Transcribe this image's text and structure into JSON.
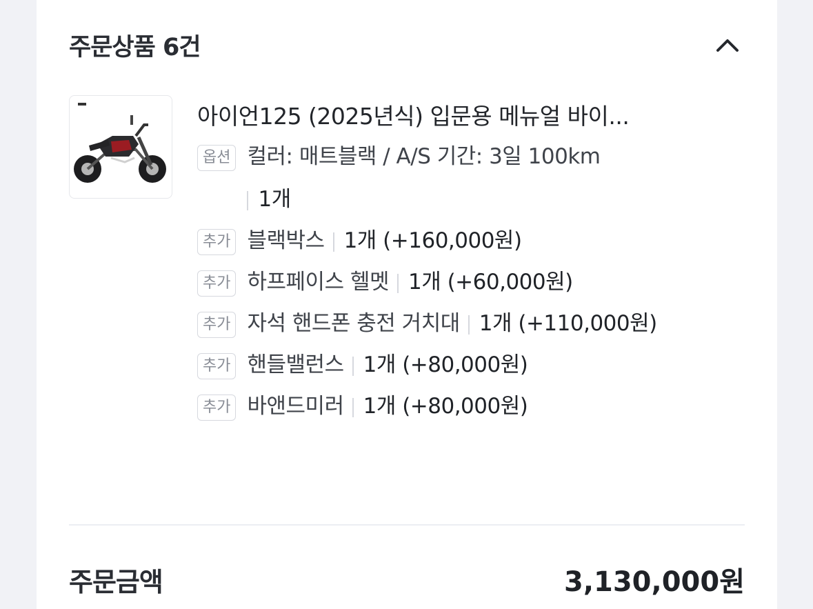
{
  "header": {
    "title": "주문상품 6건"
  },
  "product": {
    "name": "아이언125 (2025년식) 입문용 메뉴얼 바이...",
    "option": {
      "badge": "옵션",
      "text": "컬러: 매트블랙 / A/S 기간: 3일 100km",
      "qty": "1개"
    },
    "addons": [
      {
        "badge": "추가",
        "name": "블랙박스",
        "detail": "1개 (+160,000원)"
      },
      {
        "badge": "추가",
        "name": "하프페이스 헬멧",
        "detail": "1개 (+60,000원)"
      },
      {
        "badge": "추가",
        "name": "자석 핸드폰 충전 거치대",
        "detail": "1개 (+110,000원)"
      },
      {
        "badge": "추가",
        "name": "핸들밸런스",
        "detail": "1개 (+80,000원)"
      },
      {
        "badge": "추가",
        "name": "바앤드미러",
        "detail": "1개 (+80,000원)"
      }
    ]
  },
  "total": {
    "label": "주문금액",
    "amount": "3,130,000원"
  },
  "icons": {
    "collapse": "chevron-up-icon",
    "product_image": "motorcycle-image"
  },
  "colors": {
    "background": "#f1f2f6",
    "card": "#ffffff",
    "text": "#1f2227",
    "muted": "#888c95"
  }
}
